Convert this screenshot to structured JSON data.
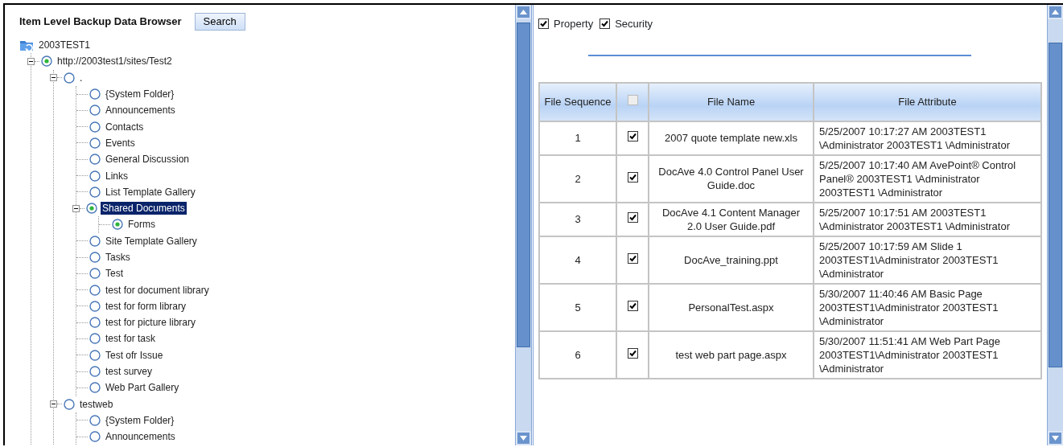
{
  "header": {
    "title": "Item Level Backup Data Browser",
    "search_button": "Search"
  },
  "tree": {
    "label": "2003TEST1",
    "children": [
      {
        "label": "http://2003test1/sites/Test2",
        "checked": true,
        "expanded": true,
        "selected": false,
        "children": [
          {
            "label": ".",
            "checked": false,
            "expanded": true,
            "selected": false,
            "children": [
              {
                "label": "{System Folder}",
                "checked": false,
                "selected": false
              },
              {
                "label": "Announcements",
                "checked": false,
                "selected": false
              },
              {
                "label": "Contacts",
                "checked": false,
                "selected": false
              },
              {
                "label": "Events",
                "checked": false,
                "selected": false
              },
              {
                "label": "General Discussion",
                "checked": false,
                "selected": false
              },
              {
                "label": "Links",
                "checked": false,
                "selected": false
              },
              {
                "label": "List Template Gallery",
                "checked": false,
                "selected": false
              },
              {
                "label": "Shared Documents",
                "checked": true,
                "expanded": true,
                "selected": true,
                "children": [
                  {
                    "label": "Forms",
                    "checked": true,
                    "selected": false
                  }
                ]
              },
              {
                "label": "Site Template Gallery",
                "checked": false,
                "selected": false
              },
              {
                "label": "Tasks",
                "checked": false,
                "selected": false
              },
              {
                "label": "Test",
                "checked": false,
                "selected": false
              },
              {
                "label": "test for document library",
                "checked": false,
                "selected": false
              },
              {
                "label": "test for form library",
                "checked": false,
                "selected": false
              },
              {
                "label": "test for picture library",
                "checked": false,
                "selected": false
              },
              {
                "label": "test for task",
                "checked": false,
                "selected": false
              },
              {
                "label": "Test ofr Issue",
                "checked": false,
                "selected": false
              },
              {
                "label": "test survey",
                "checked": false,
                "selected": false
              },
              {
                "label": "Web Part Gallery",
                "checked": false,
                "selected": false
              }
            ]
          },
          {
            "label": "testweb",
            "checked": false,
            "expanded": true,
            "selected": false,
            "children": [
              {
                "label": "{System Folder}",
                "checked": false,
                "selected": false
              },
              {
                "label": "Announcements",
                "checked": false,
                "selected": false
              }
            ]
          }
        ]
      }
    ]
  },
  "options": [
    {
      "label": "Property",
      "checked": true
    },
    {
      "label": "Security",
      "checked": true
    }
  ],
  "table": {
    "columns": [
      {
        "kind": "text",
        "label": "File Sequence"
      },
      {
        "kind": "checkbox",
        "checked": false,
        "disabled": true
      },
      {
        "kind": "text",
        "label": "File Name"
      },
      {
        "kind": "text",
        "label": "File Attribute"
      }
    ],
    "rows": [
      {
        "sequence": "1",
        "checked": true,
        "file_name": "2007 quote template new.xls",
        "file_attribute": "5/25/2007 10:17:27 AM 2003TEST1 \\Administrator 2003TEST1 \\Administrator"
      },
      {
        "sequence": "2",
        "checked": true,
        "file_name": "DocAve 4.0 Control Panel User Guide.doc",
        "file_attribute": "5/25/2007 10:17:40 AM AvePoint® Control Panel® 2003TEST1 \\Administrator 2003TEST1 \\Administrator"
      },
      {
        "sequence": "3",
        "checked": true,
        "file_name": "DocAve 4.1 Content Manager 2.0 User Guide.pdf",
        "file_attribute": "5/25/2007 10:17:51 AM 2003TEST1 \\Administrator 2003TEST1 \\Administrator"
      },
      {
        "sequence": "4",
        "checked": true,
        "file_name": "DocAve_training.ppt",
        "file_attribute": "5/25/2007 10:17:59 AM Slide 1 2003TEST1\\Administrator 2003TEST1 \\Administrator"
      },
      {
        "sequence": "5",
        "checked": true,
        "file_name": "PersonalTest.aspx",
        "file_attribute": "5/30/2007 11:40:46 AM Basic Page 2003TEST1\\Administrator 2003TEST1 \\Administrator"
      },
      {
        "sequence": "6",
        "checked": true,
        "file_name": "test web part page.aspx",
        "file_attribute": "5/30/2007 11:51:41 AM Web Part Page 2003TEST1\\Administrator 2003TEST1 \\Administrator"
      }
    ]
  }
}
